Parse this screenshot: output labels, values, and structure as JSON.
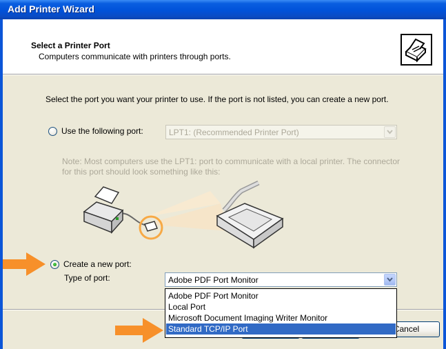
{
  "window": {
    "title": "Add Printer Wizard"
  },
  "header": {
    "title": "Select a Printer Port",
    "subtitle": "Computers communicate with printers through ports.",
    "icon": "printer-icon"
  },
  "intro_text": "Select the port you want your printer to use.  If the port is not listed, you can create a new port.",
  "use_existing": {
    "label": "Use the following port:",
    "selected": false,
    "port_value": "LPT1: (Recommended Printer Port)"
  },
  "note_text": "Note: Most computers use the LPT1: port to communicate with a local printer. The connector for this port should look something like this:",
  "create_new": {
    "label": "Create a new port:",
    "selected": true,
    "type_label": "Type of port:",
    "type_value": "Adobe PDF Port Monitor"
  },
  "port_type_options": [
    "Adobe PDF Port Monitor",
    "Local Port",
    "Microsoft Document Imaging Writer Monitor",
    "Standard TCP/IP Port"
  ],
  "highlighted_option": "Standard TCP/IP Port",
  "buttons": {
    "cancel_label": "Cancel"
  },
  "colors": {
    "title_bar": "#0052d9",
    "dialog_bg": "#ece9d8",
    "selection": "#316ac5",
    "callout_arrow": "#f7902a"
  }
}
